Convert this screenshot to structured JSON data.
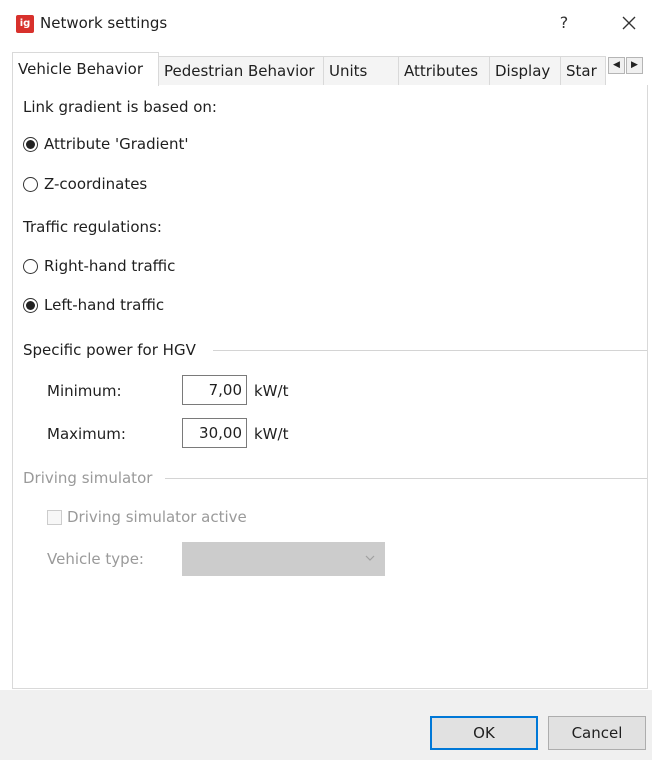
{
  "window": {
    "title": "Network settings",
    "help_glyph": "?",
    "app_icon_text": "ig"
  },
  "tabs": [
    {
      "label": "Vehicle Behavior",
      "active": true
    },
    {
      "label": "Pedestrian Behavior",
      "active": false
    },
    {
      "label": "Units",
      "active": false
    },
    {
      "label": "Attributes",
      "active": false
    },
    {
      "label": "Display",
      "active": false
    },
    {
      "label": "Star",
      "active": false
    }
  ],
  "tab_scroll": {
    "left_glyph": "◀",
    "right_glyph": "▶"
  },
  "link_gradient": {
    "heading": "Link gradient is based on:",
    "options": [
      {
        "label": "Attribute 'Gradient'",
        "checked": true
      },
      {
        "label": "Z-coordinates",
        "checked": false
      }
    ]
  },
  "traffic": {
    "heading": "Traffic regulations:",
    "options": [
      {
        "label": "Right-hand traffic",
        "checked": false
      },
      {
        "label": "Left-hand traffic",
        "checked": true
      }
    ]
  },
  "hgv": {
    "group_title": "Specific power for HGV",
    "minimum_label": "Minimum:",
    "minimum_value": "7,00",
    "maximum_label": "Maximum:",
    "maximum_value": "30,00",
    "unit": "kW/t"
  },
  "simulator": {
    "group_title": "Driving simulator",
    "checkbox_label": "Driving simulator active",
    "checkbox_checked": false,
    "vehicle_type_label": "Vehicle type:",
    "vehicle_type_value": ""
  },
  "footer": {
    "ok_label": "OK",
    "cancel_label": "Cancel"
  },
  "colors": {
    "accent": "#0078d7",
    "icon_red": "#d8312c",
    "disabled_text": "#9a9a9a"
  }
}
